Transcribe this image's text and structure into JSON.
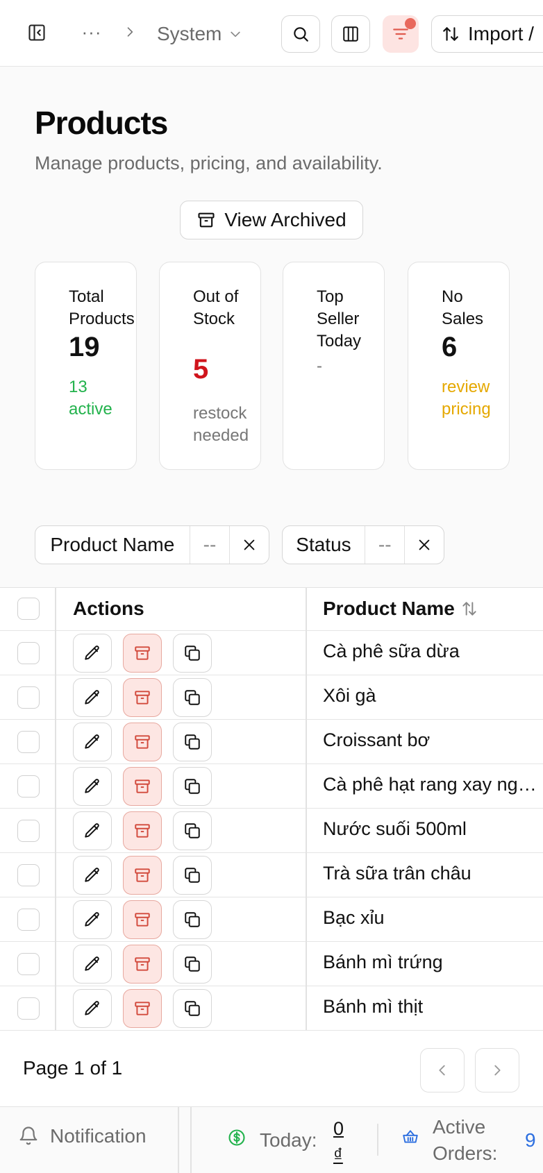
{
  "topbar": {
    "breadcrumb_ellipsis": "···",
    "breadcrumb_current": "System",
    "import_label": "Import /"
  },
  "header": {
    "title": "Products",
    "subtitle": "Manage products, pricing, and availability.",
    "archived_label": "View Archived"
  },
  "stats": [
    {
      "label": "Total Products",
      "value": "19",
      "note": "13 active",
      "note_color": "#22b24c"
    },
    {
      "label": "Out of Stock",
      "value": "5",
      "note": "restock needed",
      "note_color": "#777777",
      "value_color": "#d0141c"
    },
    {
      "label": "Top Seller Today",
      "value": "-",
      "note": ""
    },
    {
      "label": "No Sales",
      "value": "6",
      "note": "review pricing",
      "note_color": "#e5a800"
    }
  ],
  "filters": [
    {
      "field": "Product Name",
      "value": "--"
    },
    {
      "field": "Status",
      "value": "--"
    }
  ],
  "table": {
    "columns": {
      "actions": "Actions",
      "product_name": "Product Name"
    },
    "rows": [
      "Cà phê sữa dừa",
      "Xôi gà",
      "Croissant bơ",
      "Cà phê hạt rang xay nguyên chất",
      "Nước suối 500ml",
      "Trà sữa trân châu",
      "Bạc xỉu",
      "Bánh mì trứng",
      "Bánh mì thịt"
    ]
  },
  "pagination": {
    "info": "Page 1 of 1"
  },
  "statusbar": {
    "notification_label": "Notification",
    "today_label": "Today:",
    "today_value": "0 ₫",
    "orders_label": "Active Orders:",
    "orders_value": "9"
  },
  "colors": {
    "danger": "#d0141c",
    "success": "#22b24c",
    "warning": "#e5a800",
    "accent_blue": "#2d6fe0",
    "archive_bg": "#fde6e3"
  }
}
